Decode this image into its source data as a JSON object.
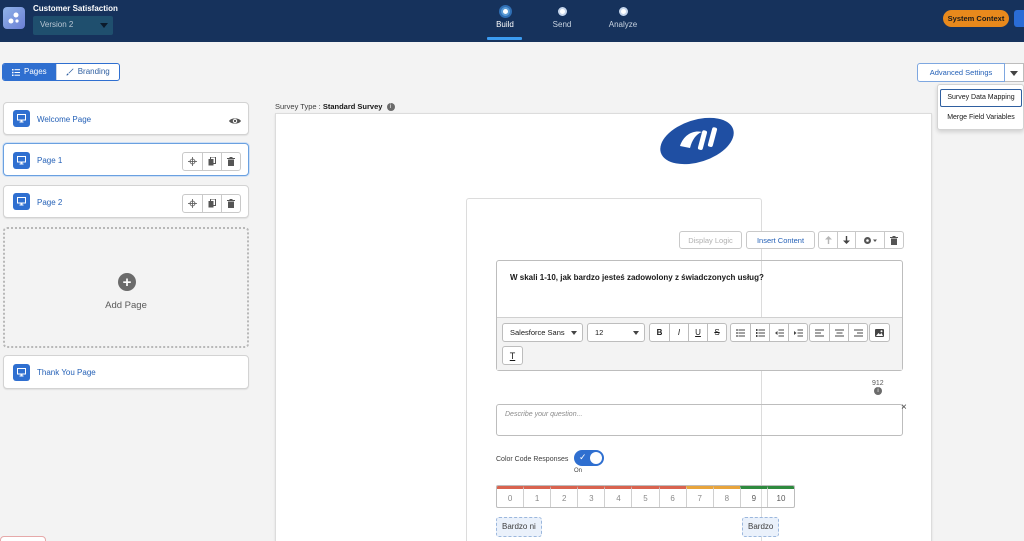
{
  "header": {
    "app_title": "Customer Satisfaction",
    "version": "Version 2",
    "steps": [
      {
        "label": "Build",
        "active": true
      },
      {
        "label": "Send",
        "active": false
      },
      {
        "label": "Analyze",
        "active": false
      }
    ],
    "system_context": "System Context"
  },
  "left_panel": {
    "tabs": {
      "pages": "Pages",
      "branding": "Branding"
    },
    "pages": [
      {
        "label": "Welcome Page"
      },
      {
        "label": "Page 1",
        "selected": true
      },
      {
        "label": "Page 2"
      }
    ],
    "add_page": "Add Page",
    "thank_you": "Thank You Page"
  },
  "survey": {
    "type_label": "Survey Type :",
    "type_value": "Standard Survey",
    "display_logic": "Display Logic",
    "insert_content": "Insert Content",
    "question": "W skali 1-10, jak bardzo jesteś zadowolony z świadczonych usług?",
    "font": "Salesforce Sans",
    "font_size": "12",
    "char_count": "912",
    "description_placeholder": "Describe your question...",
    "color_code_label": "Color Code Responses",
    "toggle_state": "On",
    "scale": [
      "0",
      "1",
      "2",
      "3",
      "4",
      "5",
      "6",
      "7",
      "8",
      "9",
      "10"
    ],
    "low_anchor": "Bardzo ni",
    "high_anchor": "Bardzo za"
  },
  "advanced": {
    "button": "Advanced Settings",
    "menu": [
      "Survey Data Mapping",
      "Merge Field Variables"
    ]
  },
  "colors": {
    "header": "#16325c",
    "brand": "#2f6fd0",
    "system_context": "#e8891c"
  }
}
